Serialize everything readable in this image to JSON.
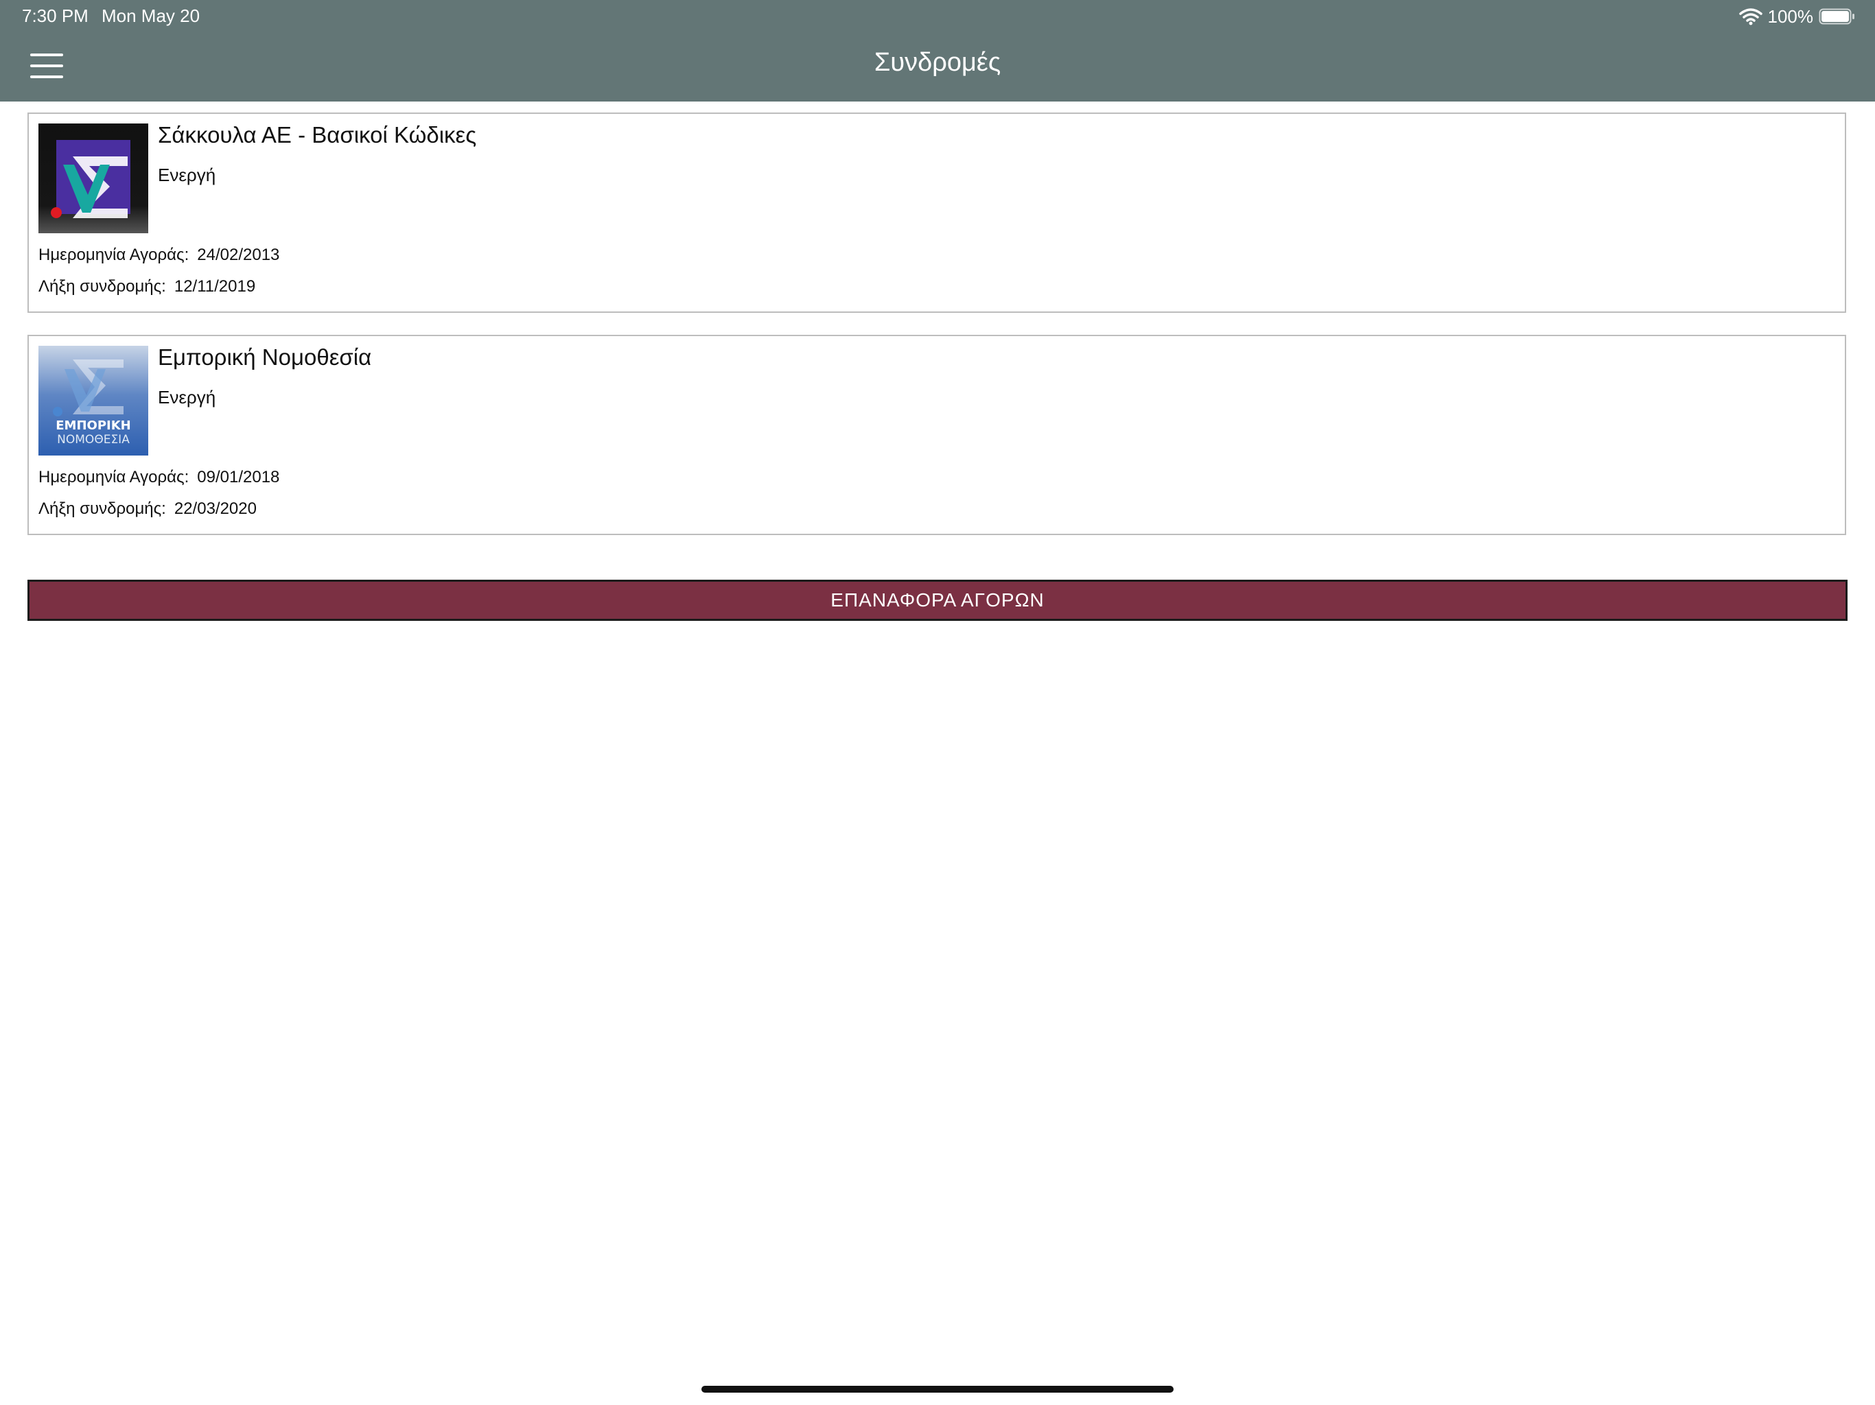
{
  "status_bar": {
    "time": "7:30 PM",
    "date": "Mon May 20",
    "battery": "100%",
    "icons": [
      "wifi-icon",
      "battery-icon"
    ]
  },
  "header": {
    "title": "Συνδρομές",
    "menu_icon": "hamburger-menu-icon",
    "background_color": "#637676"
  },
  "subscriptions": [
    {
      "name": "Σάκκουλα ΑΕ - Βασικοί Κώδικες",
      "status": "Ενεργή",
      "purchase_label": "Ημερομηνία Αγοράς:",
      "purchase_date": "24/02/2013",
      "expiry_label": "Λήξη συνδρομής:",
      "expiry_date": "12/11/2019",
      "logo": "sakkoulas-logo"
    },
    {
      "name": "Εμπορική Νομοθεσία",
      "status": "Ενεργή",
      "purchase_label": "Ημερομηνία Αγοράς:",
      "purchase_date": "09/01/2018",
      "expiry_label": "Λήξη συνδρομής:",
      "expiry_date": "22/03/2020",
      "logo": "emporiki-nomothesia-logo",
      "logo_text_line1": "ΕΜΠΟΡΙΚΗ",
      "logo_text_line2": "ΝΟΜΟΘΕΣΙΑ"
    }
  ],
  "restore_button": {
    "label": "ΕΠΑΝΑΦΟΡΑ ΑΓΟΡΩΝ",
    "color": "#7b3043"
  }
}
